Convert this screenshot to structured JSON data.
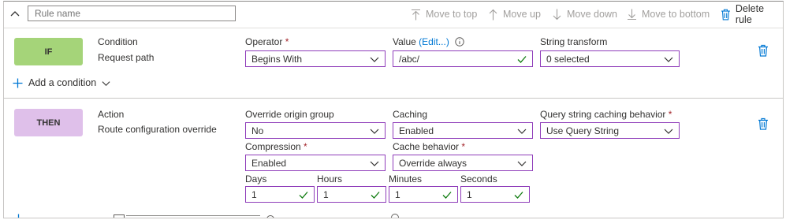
{
  "topbar": {
    "rule_name_placeholder": "Rule name",
    "move_to_top": "Move to top",
    "move_up": "Move up",
    "move_down": "Move down",
    "move_to_bottom": "Move to bottom",
    "delete_rule": "Delete rule"
  },
  "if_section": {
    "badge": "IF",
    "kind_label": "Condition",
    "kind_value": "Request path",
    "operator_label": "Operator",
    "operator_value": "Begins With",
    "value_label": "Value",
    "value_edit_link": "(Edit...)",
    "value_value": "/abc/",
    "transform_label": "String transform",
    "transform_value": "0 selected",
    "add_condition": "Add a condition"
  },
  "then_section": {
    "badge": "THEN",
    "kind_label": "Action",
    "kind_value": "Route configuration override",
    "origin_label": "Override origin group",
    "origin_value": "No",
    "caching_label": "Caching",
    "caching_value": "Enabled",
    "qs_label": "Query string caching behavior",
    "qs_value": "Use Query String",
    "compression_label": "Compression",
    "compression_value": "Enabled",
    "cache_behavior_label": "Cache behavior",
    "cache_behavior_value": "Override always",
    "days_label": "Days",
    "days_value": "1",
    "hours_label": "Hours",
    "hours_value": "1",
    "minutes_label": "Minutes",
    "minutes_value": "1",
    "seconds_label": "Seconds",
    "seconds_value": "1"
  },
  "required_marker": "*",
  "colors": {
    "accent_border": "#8f3dba",
    "if_badge": "#a5d479",
    "then_badge": "#dfc0ea",
    "link": "#0078d4",
    "check": "#107c10"
  }
}
